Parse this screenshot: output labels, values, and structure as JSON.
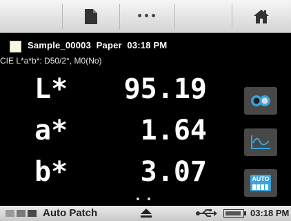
{
  "toolbar": {
    "buttons": [
      {
        "name": "document-icon"
      },
      {
        "name": "more-icon",
        "glyph": "•••"
      },
      {
        "name": "home-icon"
      }
    ]
  },
  "status": {
    "sample_name": "Sample_00003",
    "material": "Paper",
    "time": "03:18 PM",
    "swatch_color": "#fbf6dc"
  },
  "illuminant": "CIE L*a*b*: D50/2°, M0(No)",
  "measurements": [
    {
      "label": "L*",
      "value": "95.19"
    },
    {
      "label": "a*",
      "value": "1.64"
    },
    {
      "label": "b*",
      "value": "3.07"
    }
  ],
  "side_buttons": [
    {
      "name": "compare-icon"
    },
    {
      "name": "spectral-curve-icon"
    },
    {
      "name": "auto-icon",
      "label": "AUTO"
    }
  ],
  "pager": {
    "pages": 2
  },
  "bottom_bar": {
    "mode_label": "Auto Patch",
    "time": "03:18 PM"
  },
  "colors": {
    "background": "#000000",
    "toolbar": "#e6e6e6",
    "accent_blue": "#3aa3dc",
    "side_button": "#484848"
  }
}
